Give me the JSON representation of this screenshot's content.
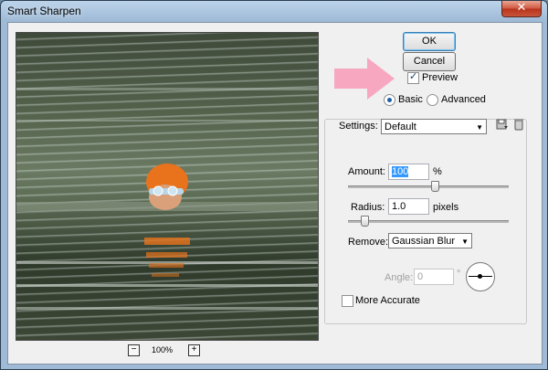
{
  "window": {
    "title": "Smart Sharpen",
    "close_glyph": "✕"
  },
  "preview": {
    "zoom_out": "−",
    "zoom_in": "+",
    "zoom_level": "100%"
  },
  "buttons": {
    "ok": "OK",
    "cancel": "Cancel"
  },
  "options": {
    "preview_label": "Preview",
    "preview_checked": true,
    "basic_label": "Basic",
    "advanced_label": "Advanced",
    "mode_selected": "Basic"
  },
  "settings": {
    "label": "Settings:",
    "value": "Default"
  },
  "amount": {
    "label": "Amount:",
    "value": "100",
    "unit": "%",
    "slider_fraction": 0.54
  },
  "radius": {
    "label": "Radius:",
    "value": "1.0",
    "unit": "pixels",
    "slider_fraction": 0.1
  },
  "remove": {
    "label": "Remove:",
    "value": "Gaussian Blur"
  },
  "angle": {
    "label": "Angle:",
    "value": "0",
    "unit": "°"
  },
  "more_accurate": {
    "label": "More Accurate",
    "checked": false
  },
  "icons": [
    "save-settings-icon",
    "delete-settings-icon",
    "annotation-arrow-icon"
  ],
  "colors": {
    "titlebar": "#9fbad6",
    "close": "#c8543a",
    "arrow": "#f7a8c0",
    "selection": "#3399ff"
  }
}
